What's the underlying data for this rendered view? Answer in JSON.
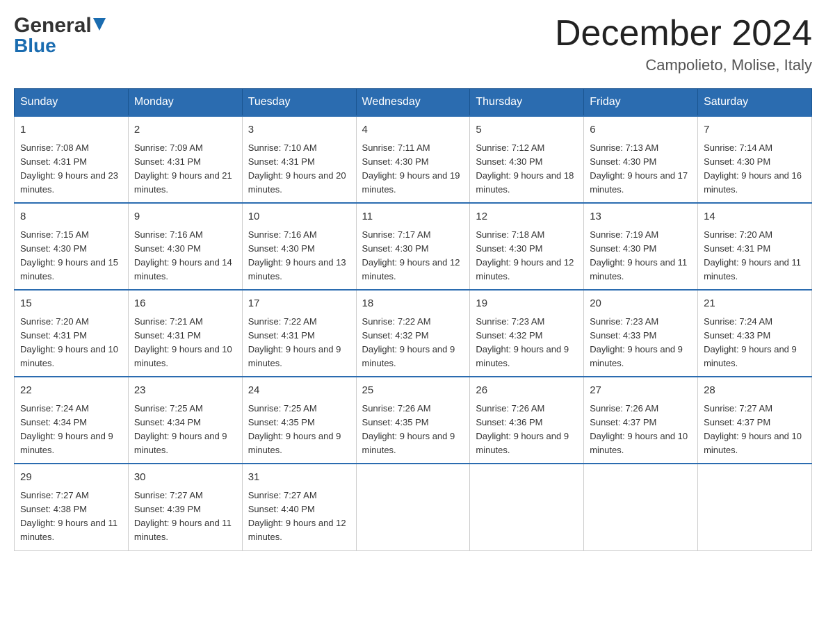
{
  "header": {
    "logo": {
      "part1": "General",
      "arrow": "▼",
      "part2": "Blue"
    },
    "title": "December 2024",
    "location": "Campolieto, Molise, Italy"
  },
  "days_of_week": [
    "Sunday",
    "Monday",
    "Tuesday",
    "Wednesday",
    "Thursday",
    "Friday",
    "Saturday"
  ],
  "weeks": [
    [
      {
        "day": "1",
        "sunrise": "Sunrise: 7:08 AM",
        "sunset": "Sunset: 4:31 PM",
        "daylight": "Daylight: 9 hours and 23 minutes."
      },
      {
        "day": "2",
        "sunrise": "Sunrise: 7:09 AM",
        "sunset": "Sunset: 4:31 PM",
        "daylight": "Daylight: 9 hours and 21 minutes."
      },
      {
        "day": "3",
        "sunrise": "Sunrise: 7:10 AM",
        "sunset": "Sunset: 4:31 PM",
        "daylight": "Daylight: 9 hours and 20 minutes."
      },
      {
        "day": "4",
        "sunrise": "Sunrise: 7:11 AM",
        "sunset": "Sunset: 4:30 PM",
        "daylight": "Daylight: 9 hours and 19 minutes."
      },
      {
        "day": "5",
        "sunrise": "Sunrise: 7:12 AM",
        "sunset": "Sunset: 4:30 PM",
        "daylight": "Daylight: 9 hours and 18 minutes."
      },
      {
        "day": "6",
        "sunrise": "Sunrise: 7:13 AM",
        "sunset": "Sunset: 4:30 PM",
        "daylight": "Daylight: 9 hours and 17 minutes."
      },
      {
        "day": "7",
        "sunrise": "Sunrise: 7:14 AM",
        "sunset": "Sunset: 4:30 PM",
        "daylight": "Daylight: 9 hours and 16 minutes."
      }
    ],
    [
      {
        "day": "8",
        "sunrise": "Sunrise: 7:15 AM",
        "sunset": "Sunset: 4:30 PM",
        "daylight": "Daylight: 9 hours and 15 minutes."
      },
      {
        "day": "9",
        "sunrise": "Sunrise: 7:16 AM",
        "sunset": "Sunset: 4:30 PM",
        "daylight": "Daylight: 9 hours and 14 minutes."
      },
      {
        "day": "10",
        "sunrise": "Sunrise: 7:16 AM",
        "sunset": "Sunset: 4:30 PM",
        "daylight": "Daylight: 9 hours and 13 minutes."
      },
      {
        "day": "11",
        "sunrise": "Sunrise: 7:17 AM",
        "sunset": "Sunset: 4:30 PM",
        "daylight": "Daylight: 9 hours and 12 minutes."
      },
      {
        "day": "12",
        "sunrise": "Sunrise: 7:18 AM",
        "sunset": "Sunset: 4:30 PM",
        "daylight": "Daylight: 9 hours and 12 minutes."
      },
      {
        "day": "13",
        "sunrise": "Sunrise: 7:19 AM",
        "sunset": "Sunset: 4:30 PM",
        "daylight": "Daylight: 9 hours and 11 minutes."
      },
      {
        "day": "14",
        "sunrise": "Sunrise: 7:20 AM",
        "sunset": "Sunset: 4:31 PM",
        "daylight": "Daylight: 9 hours and 11 minutes."
      }
    ],
    [
      {
        "day": "15",
        "sunrise": "Sunrise: 7:20 AM",
        "sunset": "Sunset: 4:31 PM",
        "daylight": "Daylight: 9 hours and 10 minutes."
      },
      {
        "day": "16",
        "sunrise": "Sunrise: 7:21 AM",
        "sunset": "Sunset: 4:31 PM",
        "daylight": "Daylight: 9 hours and 10 minutes."
      },
      {
        "day": "17",
        "sunrise": "Sunrise: 7:22 AM",
        "sunset": "Sunset: 4:31 PM",
        "daylight": "Daylight: 9 hours and 9 minutes."
      },
      {
        "day": "18",
        "sunrise": "Sunrise: 7:22 AM",
        "sunset": "Sunset: 4:32 PM",
        "daylight": "Daylight: 9 hours and 9 minutes."
      },
      {
        "day": "19",
        "sunrise": "Sunrise: 7:23 AM",
        "sunset": "Sunset: 4:32 PM",
        "daylight": "Daylight: 9 hours and 9 minutes."
      },
      {
        "day": "20",
        "sunrise": "Sunrise: 7:23 AM",
        "sunset": "Sunset: 4:33 PM",
        "daylight": "Daylight: 9 hours and 9 minutes."
      },
      {
        "day": "21",
        "sunrise": "Sunrise: 7:24 AM",
        "sunset": "Sunset: 4:33 PM",
        "daylight": "Daylight: 9 hours and 9 minutes."
      }
    ],
    [
      {
        "day": "22",
        "sunrise": "Sunrise: 7:24 AM",
        "sunset": "Sunset: 4:34 PM",
        "daylight": "Daylight: 9 hours and 9 minutes."
      },
      {
        "day": "23",
        "sunrise": "Sunrise: 7:25 AM",
        "sunset": "Sunset: 4:34 PM",
        "daylight": "Daylight: 9 hours and 9 minutes."
      },
      {
        "day": "24",
        "sunrise": "Sunrise: 7:25 AM",
        "sunset": "Sunset: 4:35 PM",
        "daylight": "Daylight: 9 hours and 9 minutes."
      },
      {
        "day": "25",
        "sunrise": "Sunrise: 7:26 AM",
        "sunset": "Sunset: 4:35 PM",
        "daylight": "Daylight: 9 hours and 9 minutes."
      },
      {
        "day": "26",
        "sunrise": "Sunrise: 7:26 AM",
        "sunset": "Sunset: 4:36 PM",
        "daylight": "Daylight: 9 hours and 9 minutes."
      },
      {
        "day": "27",
        "sunrise": "Sunrise: 7:26 AM",
        "sunset": "Sunset: 4:37 PM",
        "daylight": "Daylight: 9 hours and 10 minutes."
      },
      {
        "day": "28",
        "sunrise": "Sunrise: 7:27 AM",
        "sunset": "Sunset: 4:37 PM",
        "daylight": "Daylight: 9 hours and 10 minutes."
      }
    ],
    [
      {
        "day": "29",
        "sunrise": "Sunrise: 7:27 AM",
        "sunset": "Sunset: 4:38 PM",
        "daylight": "Daylight: 9 hours and 11 minutes."
      },
      {
        "day": "30",
        "sunrise": "Sunrise: 7:27 AM",
        "sunset": "Sunset: 4:39 PM",
        "daylight": "Daylight: 9 hours and 11 minutes."
      },
      {
        "day": "31",
        "sunrise": "Sunrise: 7:27 AM",
        "sunset": "Sunset: 4:40 PM",
        "daylight": "Daylight: 9 hours and 12 minutes."
      },
      {
        "day": "",
        "sunrise": "",
        "sunset": "",
        "daylight": ""
      },
      {
        "day": "",
        "sunrise": "",
        "sunset": "",
        "daylight": ""
      },
      {
        "day": "",
        "sunrise": "",
        "sunset": "",
        "daylight": ""
      },
      {
        "day": "",
        "sunrise": "",
        "sunset": "",
        "daylight": ""
      }
    ]
  ]
}
